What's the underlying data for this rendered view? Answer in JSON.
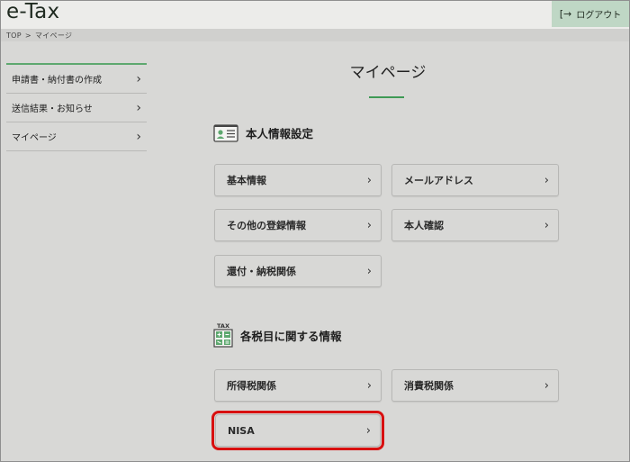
{
  "header": {
    "logo": "e-Tax",
    "logout_label": "ログアウト",
    "logout_icon": "logout-icon"
  },
  "breadcrumb": {
    "home": "TOP",
    "separator": ">",
    "current": "マイページ"
  },
  "sidebar": {
    "items": [
      {
        "label": "申請書・納付書の作成"
      },
      {
        "label": "送信結果・お知らせ"
      },
      {
        "label": "マイページ"
      }
    ]
  },
  "main": {
    "title": "マイページ",
    "sections": [
      {
        "title": "本人情報設定",
        "icon": "id-card-icon",
        "cards": [
          {
            "label": "基本情報"
          },
          {
            "label": "メールアドレス"
          },
          {
            "label": "その他の登録情報"
          },
          {
            "label": "本人確認"
          },
          {
            "label": "還付・納税関係"
          }
        ]
      },
      {
        "title": "各税目に関する情報",
        "icon": "tax-calculator-icon",
        "icon_text": "TAX",
        "cards": [
          {
            "label": "所得税関係"
          },
          {
            "label": "消費税関係"
          },
          {
            "label": "NISA"
          }
        ]
      }
    ]
  },
  "colors": {
    "accent": "#3e9a55",
    "highlight": "#d81010",
    "background": "#d8d8d6"
  }
}
